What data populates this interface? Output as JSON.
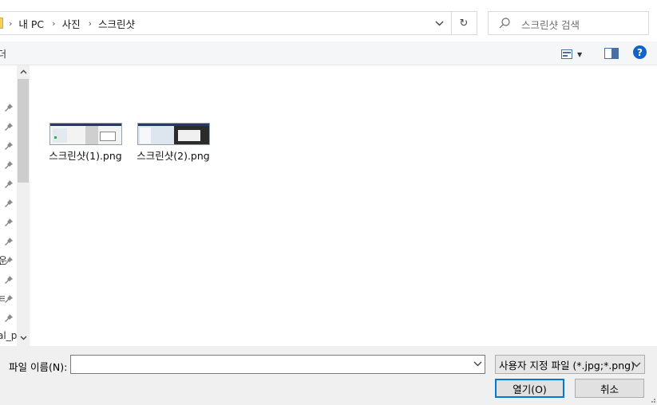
{
  "address_bar": {
    "crumbs": [
      "내 PC",
      "사진",
      "스크린샷"
    ],
    "separator": "›"
  },
  "search": {
    "placeholder": "스크린샷 검색"
  },
  "toolbar": {
    "partial_label": "더"
  },
  "nav_pane": {
    "clipped_labels": [
      "운",
      "ㅌ",
      "al_p("
    ],
    "pinned_count": 12
  },
  "files": [
    {
      "name": "스크린샷(1).png"
    },
    {
      "name": "스크린샷(2).png"
    }
  ],
  "bottom": {
    "filename_label": "파일 이름(N):",
    "filename_value": "",
    "filter_label": "사용자 지정 파일 (*.jpg;*.png)",
    "open_label": "열기(O)",
    "cancel_label": "취소"
  },
  "icons": {
    "help": "?",
    "refresh": "↻",
    "dropdown": "⌄"
  },
  "colors": {
    "accent": "#0078d7",
    "help": "#1464c8",
    "folder": "#f5cf5a"
  }
}
